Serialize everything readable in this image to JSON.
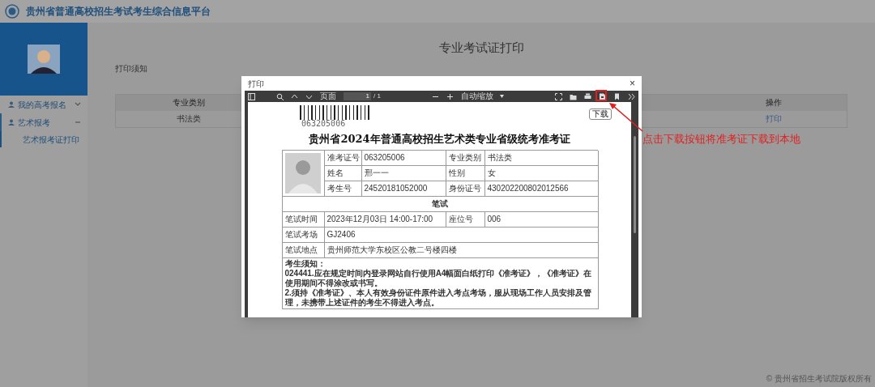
{
  "header": {
    "title": "贵州省普通高校招生考试考生综合信息平台"
  },
  "sidebar": {
    "items": [
      {
        "label": "我的高考报名",
        "expanded": false
      },
      {
        "label": "艺术报考",
        "expanded": true,
        "children": [
          {
            "label": "艺术报考证打印",
            "selected": true
          }
        ]
      }
    ]
  },
  "page": {
    "title": "专业考试证打印",
    "notice_title": "打印须知"
  },
  "table": {
    "columns": [
      "专业类别",
      "操作"
    ],
    "rows": [
      [
        "书法类",
        "打印"
      ]
    ]
  },
  "dialog": {
    "title": "打印",
    "close": "×",
    "toolbar": {
      "page_label": "页面",
      "page_input": "1",
      "page_count": "/ 1",
      "zoom": "自动缩放"
    },
    "tooltip": "下载",
    "document": {
      "barcode_number": "063205006",
      "title": "贵州省2024年普通高校招生艺术类专业省级统考准考证",
      "info_rows": [
        [
          "准考证号",
          "063205006",
          "专业类别",
          "书法类"
        ],
        [
          "姓名",
          "邢一一",
          "性别",
          "女"
        ],
        [
          "考生号",
          "24520181052000",
          "身份证号",
          "430202200802012566"
        ]
      ],
      "section": "笔试",
      "exam_rows": [
        [
          "笔试时间",
          "2023年12月03日 14:00-17:00",
          "座位号",
          "006"
        ],
        [
          "笔试考场",
          "GJ2406"
        ],
        [
          "笔试地点",
          "贵州师范大学东校区公教二号楼四楼"
        ]
      ],
      "notes_title": "考生须知：",
      "notes": [
        "024441.应在规定时间内登录网站自行使用A4幅面白纸打印《准考证》，《准考证》在使用期间不得涂改或书写。",
        "2.须持《准考证》、本人有效身份证件原件进入考点考场，服从现场工作人员安排及管理，未携带上述证件的考生不得进入考点。"
      ]
    }
  },
  "annotation": {
    "text": "点击下载按钮将准考证下载到本地"
  },
  "footer": "© 贵州省招生考试院版权所有"
}
